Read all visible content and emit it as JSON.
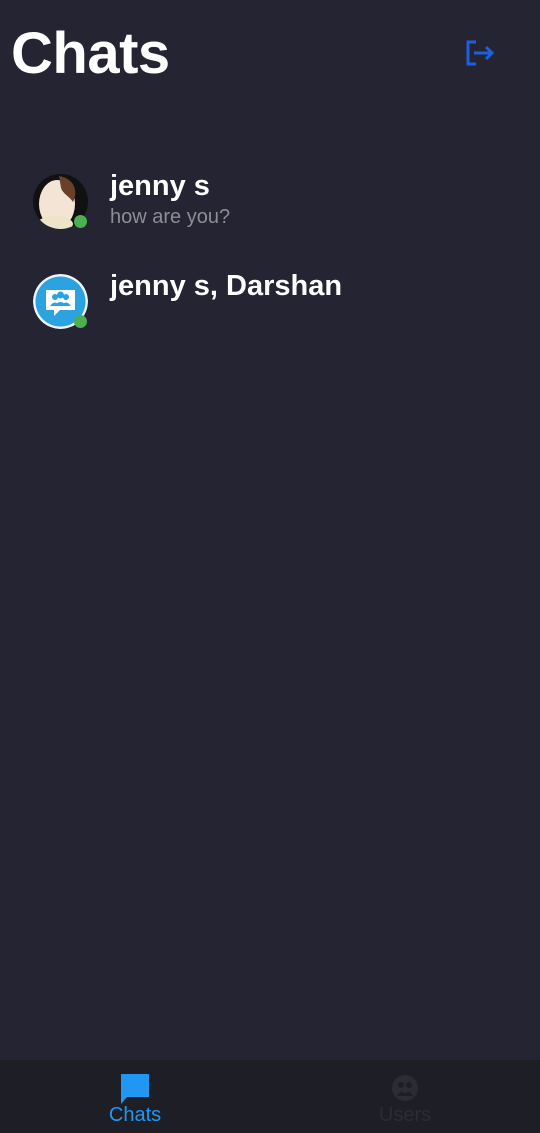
{
  "header": {
    "title": "Chats",
    "logout_icon": "logout-icon",
    "accent": "#1e5fe0"
  },
  "chats": [
    {
      "name": "jenny s",
      "last_message": "how are you?",
      "avatar": "photo",
      "online": true
    },
    {
      "name": "jenny s, Darshan",
      "last_message": "",
      "avatar": "group-chat-icon",
      "online": true
    }
  ],
  "tabs": [
    {
      "label": "Chats",
      "icon": "chat-bubble-icon",
      "active": true,
      "color": "#2196f3"
    },
    {
      "label": "Users",
      "icon": "users-icon",
      "active": false,
      "color": "#2c2c34"
    }
  ]
}
